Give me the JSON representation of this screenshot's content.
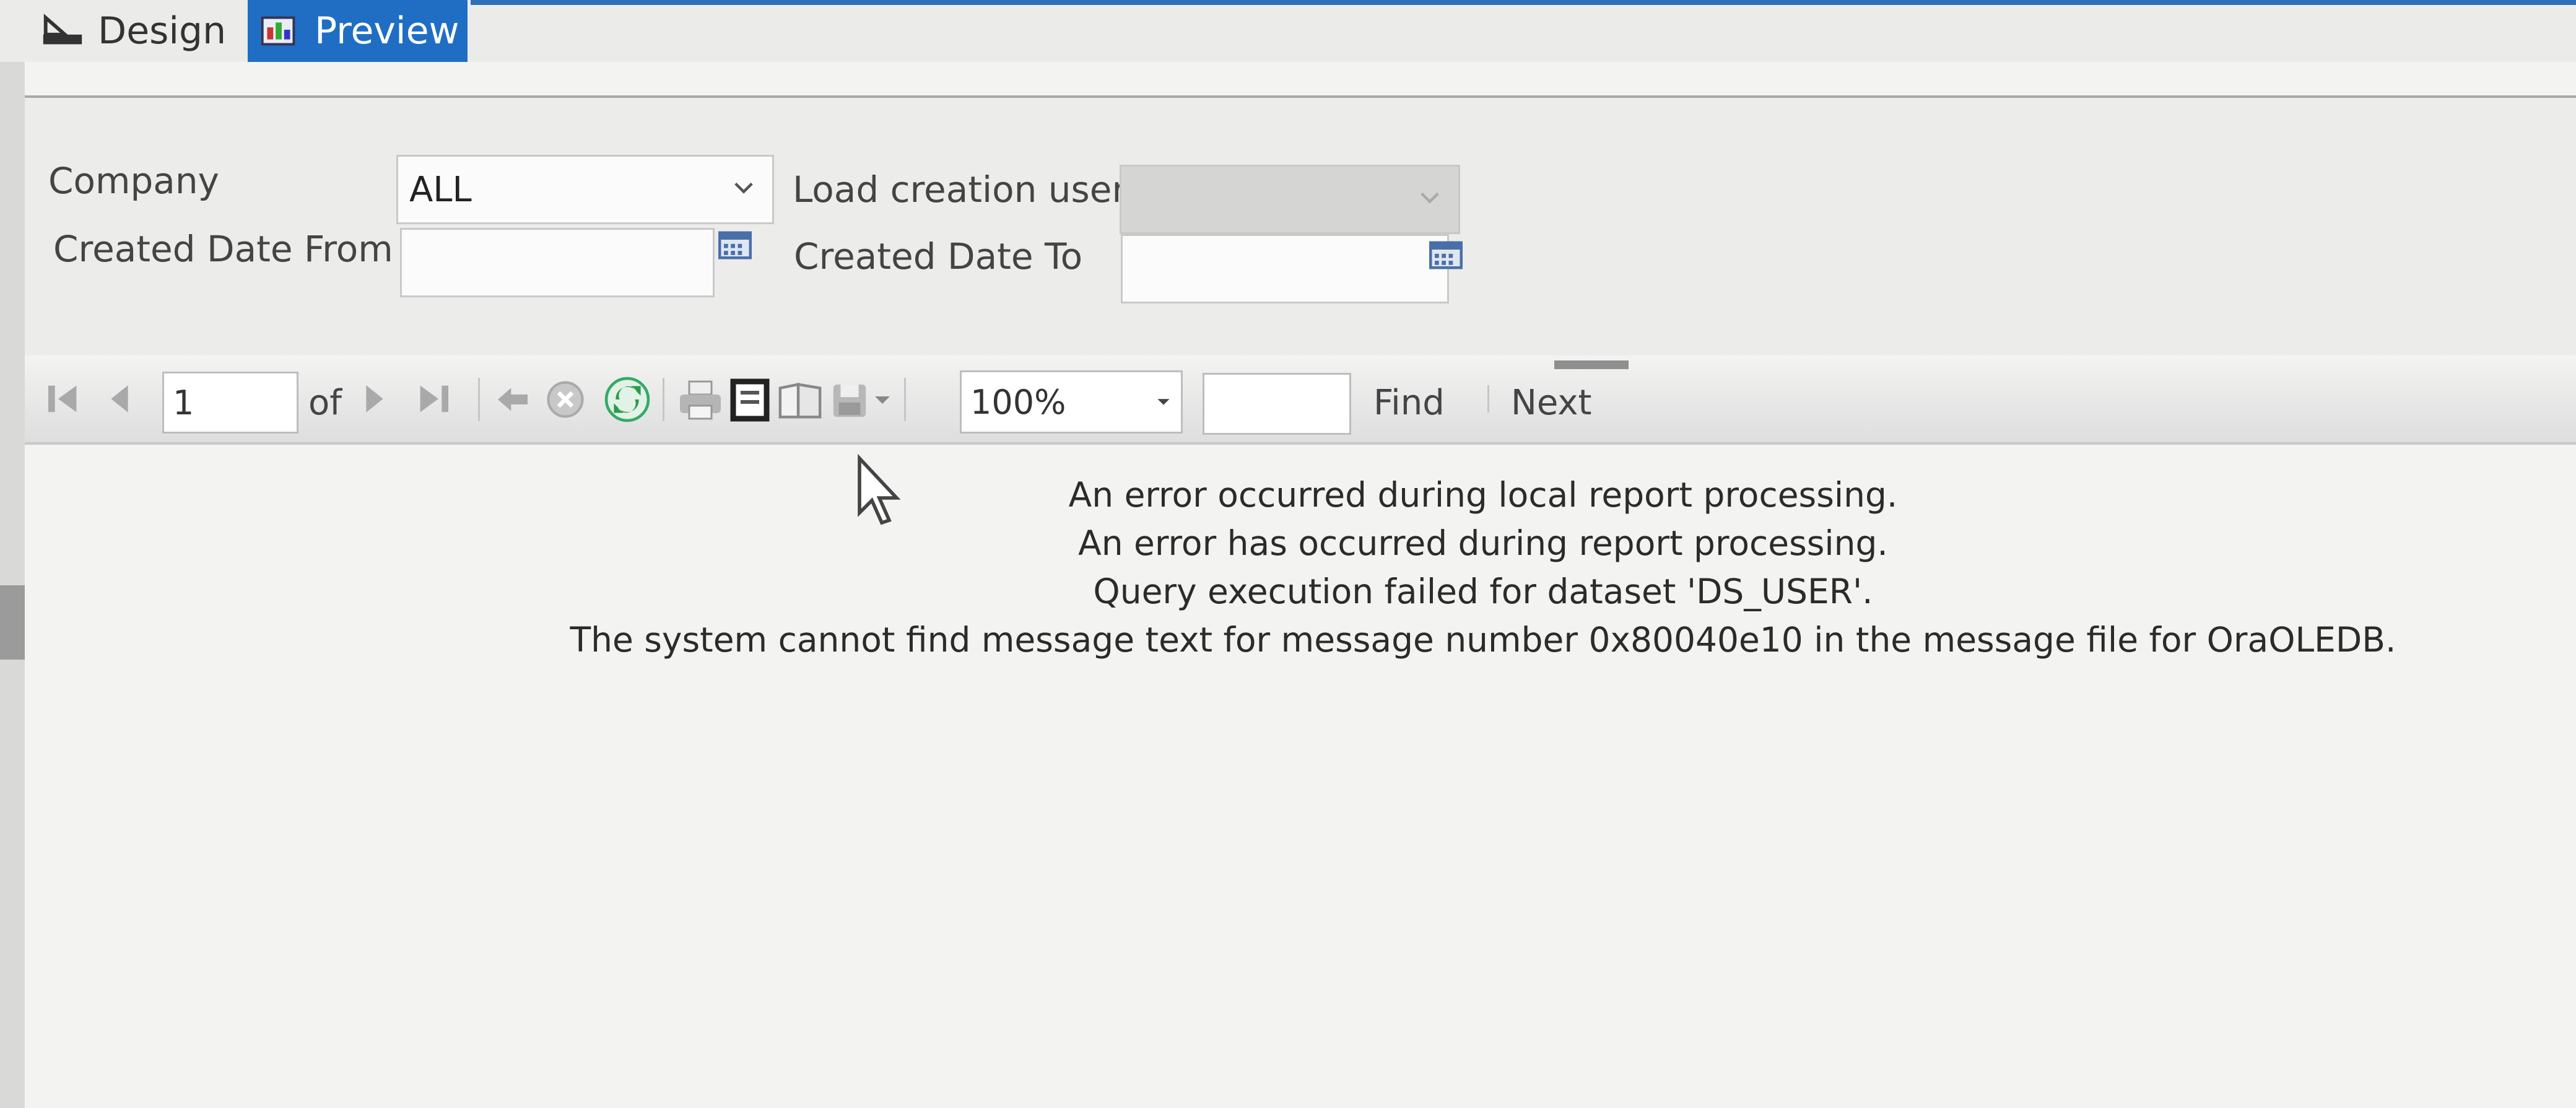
{
  "tabs": {
    "design": "Design",
    "preview": "Preview"
  },
  "parameters": {
    "company_label": "Company",
    "company_value": "ALL",
    "load_user_label": "Load creation user",
    "load_user_value": "",
    "date_from_label": "Created Date From",
    "date_from_value": "",
    "date_to_label": "Created Date To",
    "date_to_value": ""
  },
  "toolbar": {
    "page_value": "1",
    "of_label": "of",
    "zoom_value": "100%",
    "find_value": "",
    "find_label": "Find",
    "next_label": "Next"
  },
  "messages": [
    "An error occurred during local report processing.",
    "An error has occurred during report processing.",
    "Query execution failed for dataset 'DS_USER'.",
    "The system cannot find message text for message number 0x80040e10 in the message file for OraOLEDB."
  ],
  "icons": [
    "design-icon",
    "preview-icon",
    "chevron-down-icon",
    "calendar-icon",
    "first-page-icon",
    "prev-page-icon",
    "next-page-icon",
    "last-page-icon",
    "back-icon",
    "stop-icon",
    "refresh-icon",
    "print-icon",
    "print-layout-icon",
    "page-setup-icon",
    "export-icon",
    "dropdown-arrow-icon",
    "mouse-cursor-icon"
  ],
  "colors": {
    "accent": "#1f6ec4",
    "refresh": "#2a9b4a",
    "background": "#f3f3f2"
  }
}
